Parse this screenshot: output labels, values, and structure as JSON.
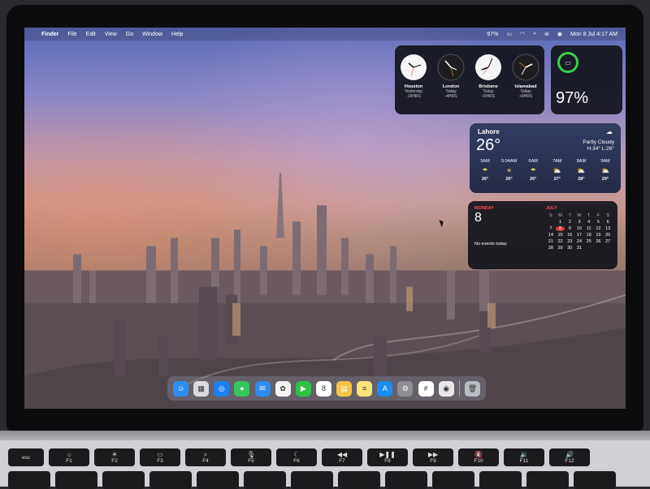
{
  "menubar": {
    "app_name": "Finder",
    "menus": [
      "File",
      "Edit",
      "View",
      "Go",
      "Window",
      "Help"
    ],
    "battery": "97%",
    "datetime": "Mon 8 Jul  4:17 AM"
  },
  "world_clock": [
    {
      "city": "Houston",
      "day": "Yesterday",
      "offset": "-10HRS"
    },
    {
      "city": "London",
      "day": "Today",
      "offset": "-4HRS"
    },
    {
      "city": "Brisbane",
      "day": "Today",
      "offset": "+5HRS"
    },
    {
      "city": "Islamabad",
      "day": "Today",
      "offset": "+0HRS"
    }
  ],
  "battery_widget": {
    "percent": "97%",
    "accent": "#36d14a"
  },
  "weather": {
    "location": "Lahore",
    "temperature": "26°",
    "condition": "Partly Cloudy",
    "high_low": "H:34° L:26°",
    "hourly": [
      {
        "time": "5AM",
        "icon": "cloud-rain-icon",
        "temp": "26°"
      },
      {
        "time": "5:04AM",
        "icon": "sunrise-icon",
        "temp": "26°"
      },
      {
        "time": "6AM",
        "icon": "cloud-rain-icon",
        "temp": "26°"
      },
      {
        "time": "7AM",
        "icon": "cloud-sun-icon",
        "temp": "27°"
      },
      {
        "time": "8AM",
        "icon": "cloud-sun-icon",
        "temp": "28°"
      },
      {
        "time": "9AM",
        "icon": "cloud-sun-icon",
        "temp": "29°"
      }
    ]
  },
  "calendar": {
    "weekday": "MONDAY",
    "date": "8",
    "events_text": "No events today",
    "month": "JULY",
    "headers": [
      "S",
      "M",
      "T",
      "W",
      "T",
      "F",
      "S"
    ],
    "days": [
      "",
      "1",
      "2",
      "3",
      "4",
      "5",
      "6",
      "7",
      "8",
      "9",
      "10",
      "11",
      "12",
      "13",
      "14",
      "15",
      "16",
      "17",
      "18",
      "19",
      "20",
      "21",
      "22",
      "23",
      "24",
      "25",
      "26",
      "27",
      "28",
      "29",
      "30",
      "31",
      "",
      "",
      ""
    ],
    "today": "8",
    "accent": "#e53c3c"
  },
  "dock": {
    "apps": [
      {
        "name": "finder-icon",
        "glyph": "☺",
        "color": "#2f8cf0"
      },
      {
        "name": "launchpad-icon",
        "glyph": "▦",
        "color": "#d9d9de"
      },
      {
        "name": "safari-icon",
        "glyph": "◎",
        "color": "#1e7ff5"
      },
      {
        "name": "messages-icon",
        "glyph": "●",
        "color": "#34c759"
      },
      {
        "name": "mail-icon",
        "glyph": "✉",
        "color": "#2d8cf0"
      },
      {
        "name": "photos-icon",
        "glyph": "✿",
        "color": "#f4f4f4"
      },
      {
        "name": "facetime-icon",
        "glyph": "▶",
        "color": "#30c048"
      },
      {
        "name": "calendar-icon",
        "glyph": "8",
        "color": "#ffffff"
      },
      {
        "name": "notes-app-icon",
        "glyph": "▤",
        "color": "#f6c445"
      },
      {
        "name": "notes-icon",
        "glyph": "≡",
        "color": "#fbe27a"
      },
      {
        "name": "app-store-icon",
        "glyph": "A",
        "color": "#1b8df5"
      },
      {
        "name": "system-settings-icon",
        "glyph": "⚙",
        "color": "#8e8e93"
      },
      {
        "name": "slack-icon",
        "glyph": "#",
        "color": "#ffffff"
      },
      {
        "name": "chrome-icon",
        "glyph": "◉",
        "color": "#e8e8e8"
      },
      {
        "name": "trash-icon",
        "glyph": "🗑",
        "color": "#b9bcc2"
      }
    ]
  },
  "keyboard": {
    "keys": [
      {
        "label": "esc",
        "icon": ""
      },
      {
        "label": "F1",
        "icon": "☼"
      },
      {
        "label": "F2",
        "icon": "☀"
      },
      {
        "label": "F3",
        "icon": "▭"
      },
      {
        "label": "F4",
        "icon": "⌕"
      },
      {
        "label": "F5",
        "icon": "🎙"
      },
      {
        "label": "F6",
        "icon": "☾"
      },
      {
        "label": "F7",
        "icon": "◀◀"
      },
      {
        "label": "F8",
        "icon": "▶❚❚"
      },
      {
        "label": "F9",
        "icon": "▶▶"
      },
      {
        "label": "F10",
        "icon": "🔇"
      },
      {
        "label": "F11",
        "icon": "🔉"
      },
      {
        "label": "F12",
        "icon": "🔊"
      }
    ]
  }
}
